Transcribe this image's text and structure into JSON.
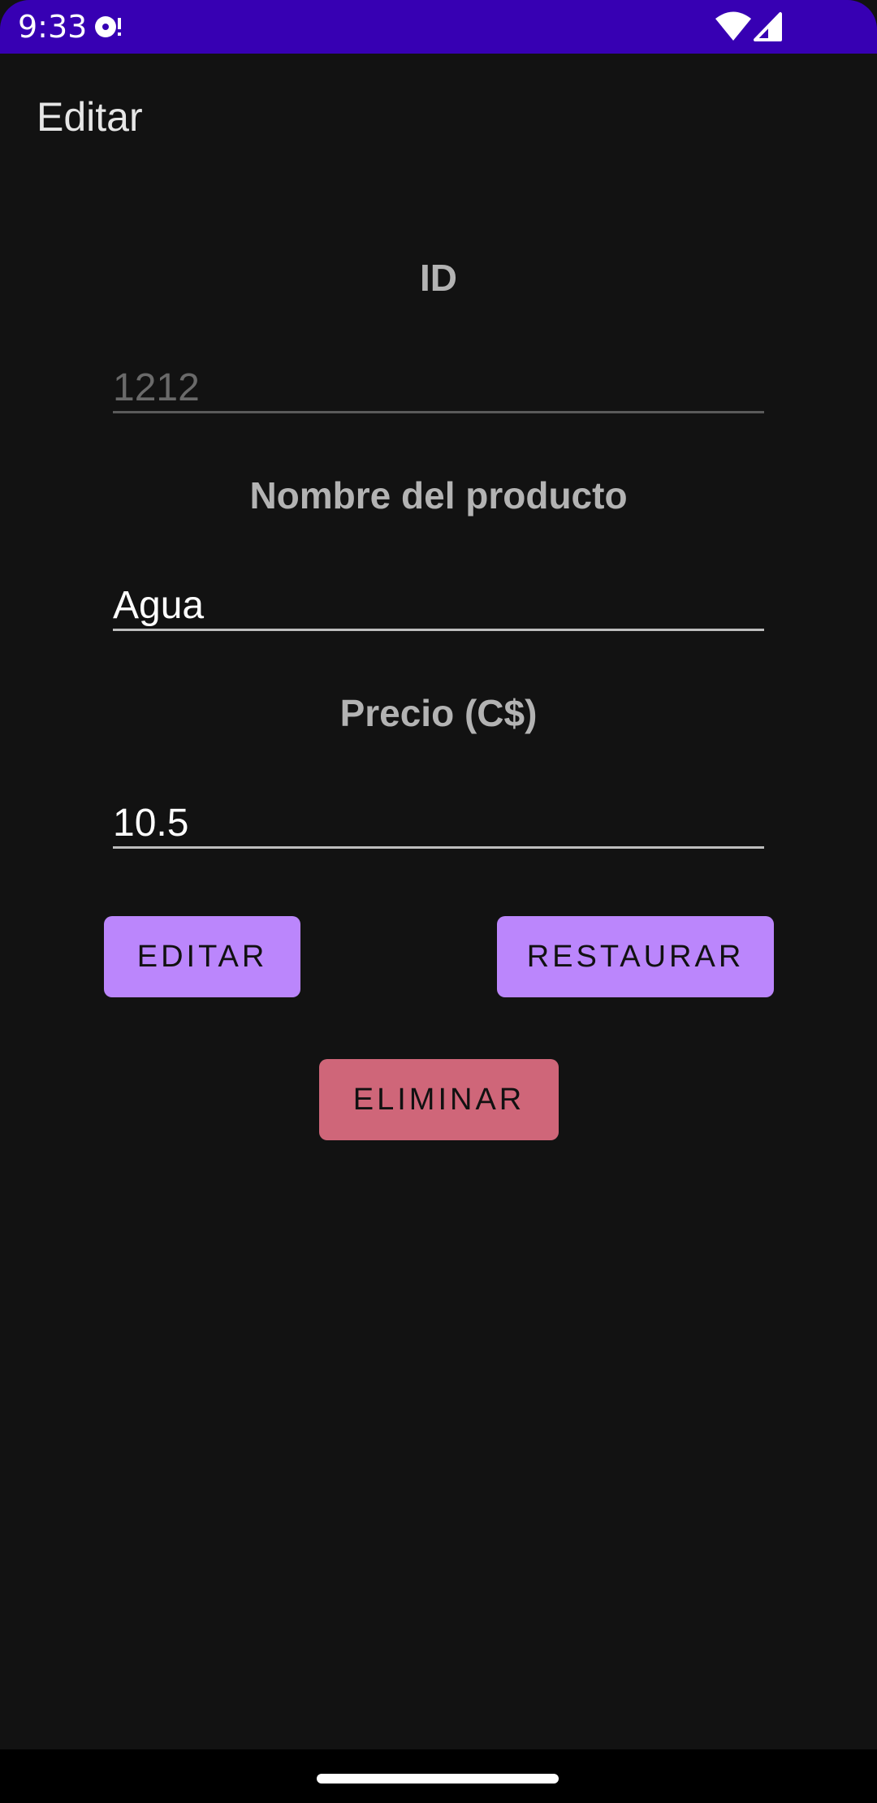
{
  "status_bar": {
    "time": "9:33",
    "notification_icon": "media-notification-icon",
    "wifi_icon": "wifi-icon",
    "signal_icon": "cell-signal-icon",
    "background_color": "#3700B3"
  },
  "app_bar": {
    "title": "Editar"
  },
  "form": {
    "id_label": "ID",
    "id_value": "1212",
    "name_label": "Nombre del producto",
    "name_value": "Agua",
    "price_label": "Precio (C$)",
    "price_value": "10.5"
  },
  "buttons": {
    "edit_label": "EDITAR",
    "restore_label": "RESTAURAR",
    "delete_label": "ELIMINAR"
  },
  "colors": {
    "primary_button": "#BB86FC",
    "delete_button": "#CF6679",
    "background": "#121212"
  },
  "nav_bar": {
    "handle": "gesture-handle"
  }
}
